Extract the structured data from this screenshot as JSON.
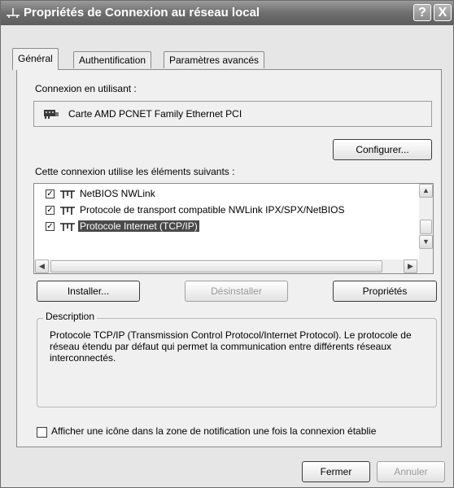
{
  "window": {
    "title": "Propriétés de Connexion au réseau local",
    "help_label": "?",
    "close_label": "X"
  },
  "tabs": [
    {
      "label": "Général"
    },
    {
      "label": "Authentification"
    },
    {
      "label": "Paramètres avancés"
    }
  ],
  "connection": {
    "label": "Connexion en utilisant :",
    "adapter_name": "Carte AMD PCNET Family Ethernet PCI",
    "configure_button": "Configurer..."
  },
  "components": {
    "label": "Cette connexion utilise les éléments suivants :",
    "items": [
      {
        "label": "NetBIOS NWLink",
        "checked": true,
        "selected": false
      },
      {
        "label": "Protocole de transport compatible NWLink IPX/SPX/NetBIOS",
        "checked": true,
        "selected": false
      },
      {
        "label": "Protocole Internet (TCP/IP)",
        "checked": true,
        "selected": true
      }
    ]
  },
  "actions": {
    "install": "Installer...",
    "uninstall": "Désinstaller",
    "properties": "Propriétés"
  },
  "description": {
    "title": "Description",
    "text": "Protocole TCP/IP (Transmission Control Protocol/Internet Protocol). Le protocole de réseau étendu par défaut qui permet la communication entre différents réseaux interconnectés."
  },
  "notification": {
    "label": "Afficher une icône dans la zone de notification une fois la connexion établie",
    "checked": false
  },
  "footer": {
    "close": "Fermer",
    "cancel": "Annuler"
  },
  "colors": {
    "titlebar": "#6e6e6e",
    "selection": "#4a4a4a",
    "dialog_bg": "#f0f0f0"
  },
  "icons": {
    "title": "network-connection-icon",
    "adapter": "network-card-icon",
    "protocol": "protocol-icon"
  }
}
